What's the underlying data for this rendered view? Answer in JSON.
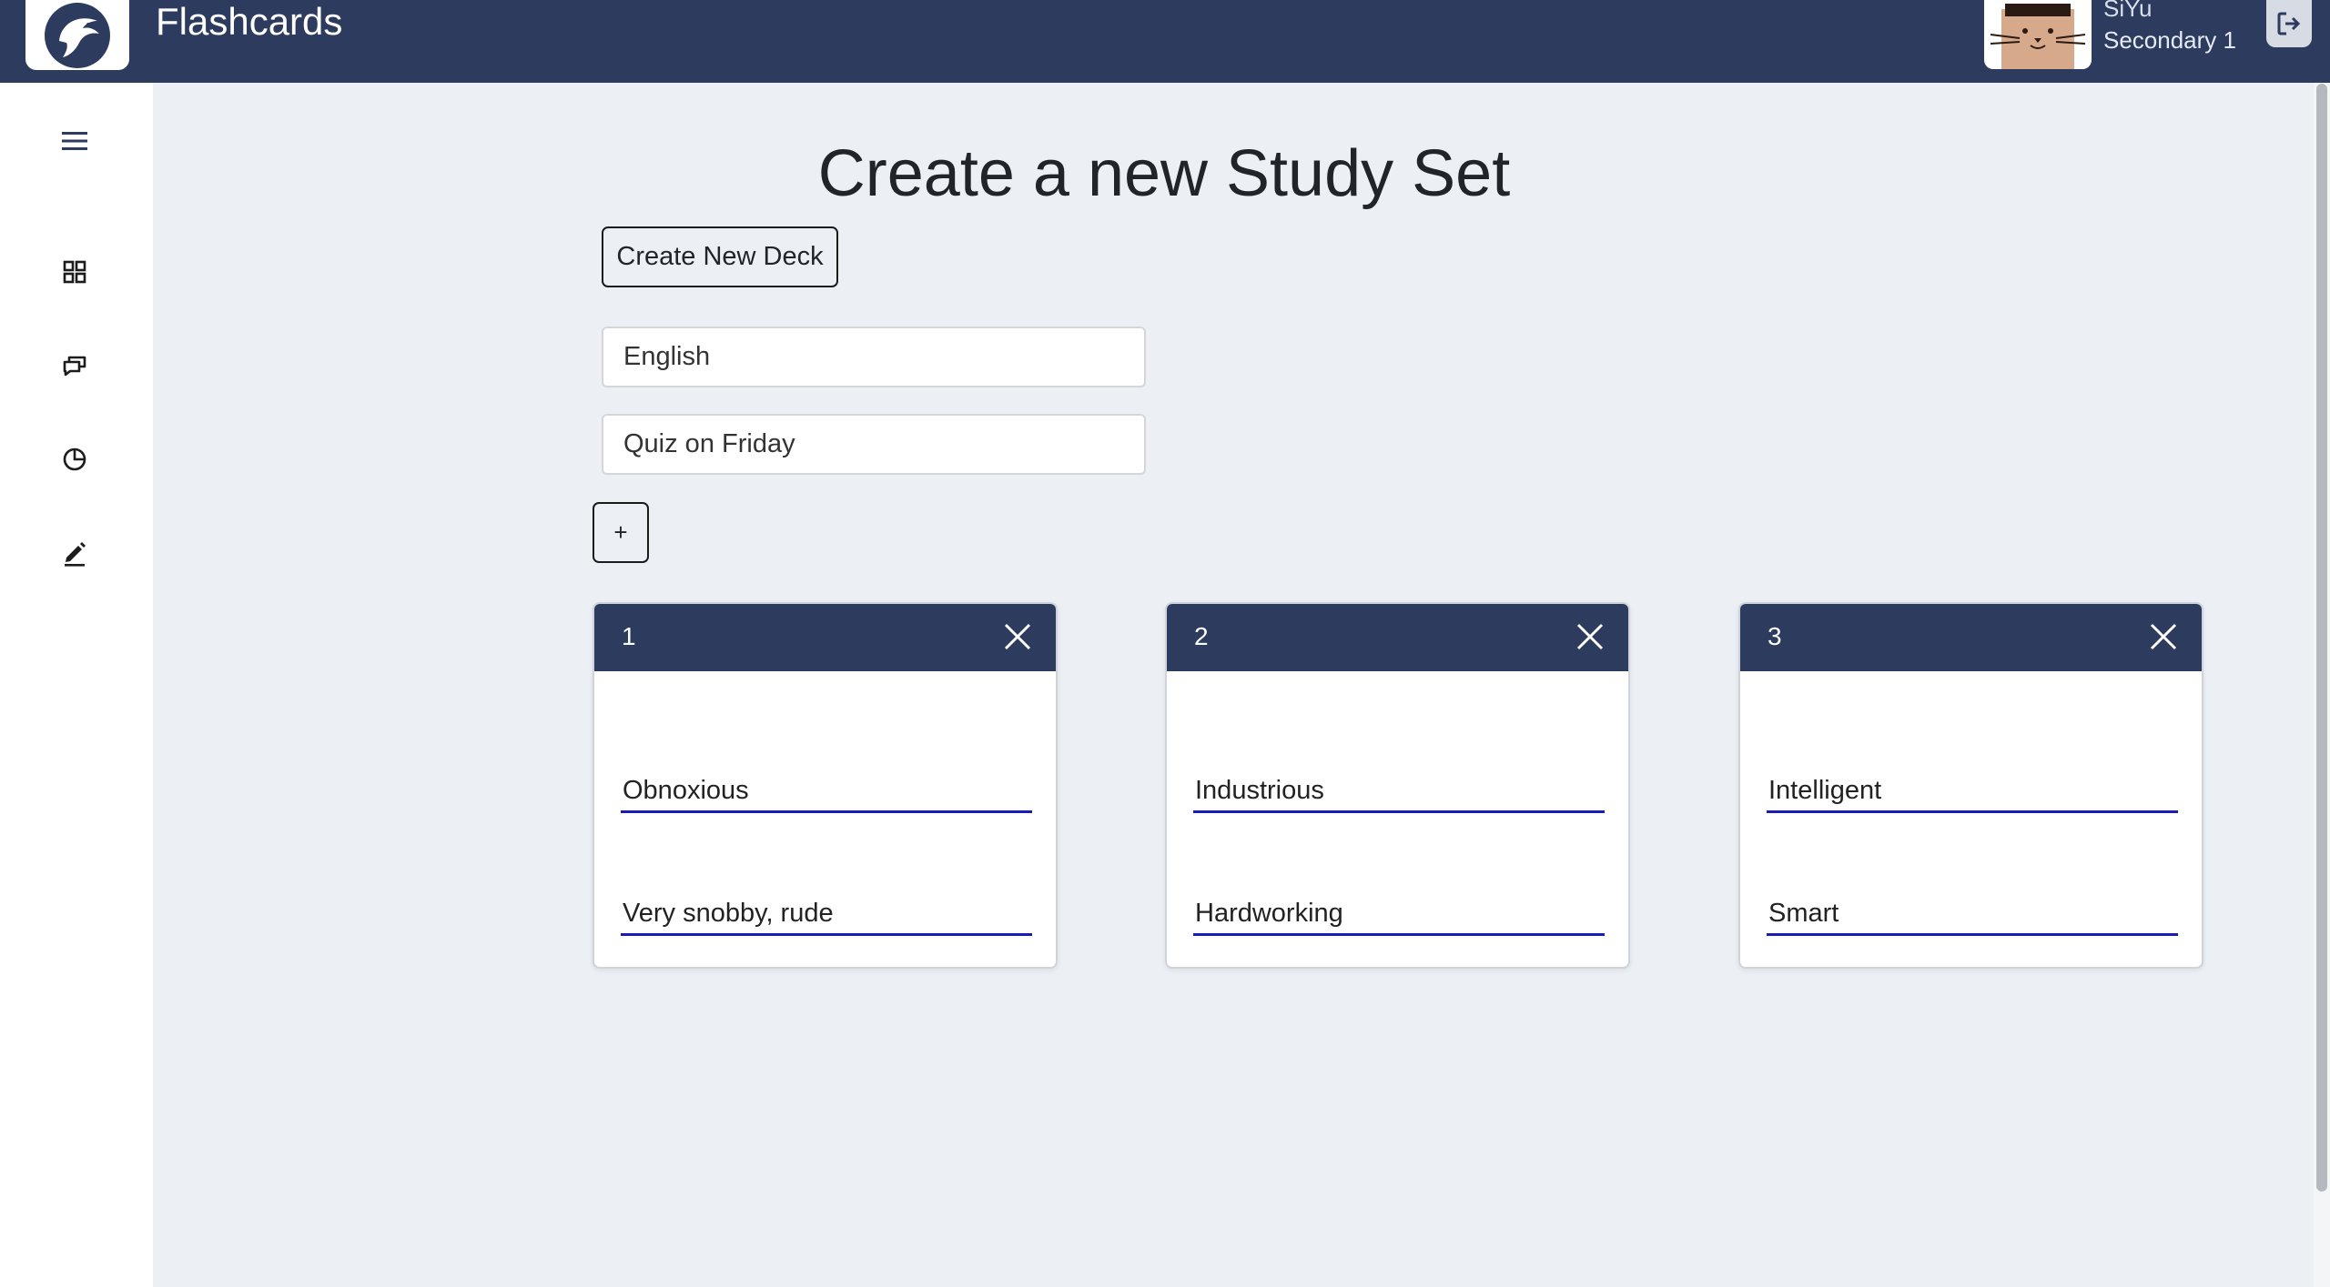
{
  "header": {
    "app_title": "Flashcards",
    "user": {
      "name": "SiYu",
      "level": "Secondary 1"
    },
    "colors": {
      "bar": "#2c3b5e"
    },
    "icons": {
      "logo": "eagle-logo",
      "avatar": "cat-avatar",
      "logout": "logout-icon"
    }
  },
  "sidebar": {
    "items": [
      {
        "icon": "menu-icon"
      },
      {
        "icon": "dashboard-grid-icon"
      },
      {
        "icon": "chat-icon"
      },
      {
        "icon": "pie-chart-icon"
      },
      {
        "icon": "pencil-icon"
      }
    ]
  },
  "main": {
    "title": "Create a new Study Set",
    "create_deck_label": "Create New Deck",
    "subject_value": "English",
    "description_value": "Quiz on Friday",
    "add_card_label": "+",
    "cards": [
      {
        "number": "1",
        "term": "Obnoxious",
        "definition": "Very snobby, rude"
      },
      {
        "number": "2",
        "term": "Industrious",
        "definition": "Hardworking"
      },
      {
        "number": "3",
        "term": "Intelligent",
        "definition": "Smart"
      }
    ]
  }
}
